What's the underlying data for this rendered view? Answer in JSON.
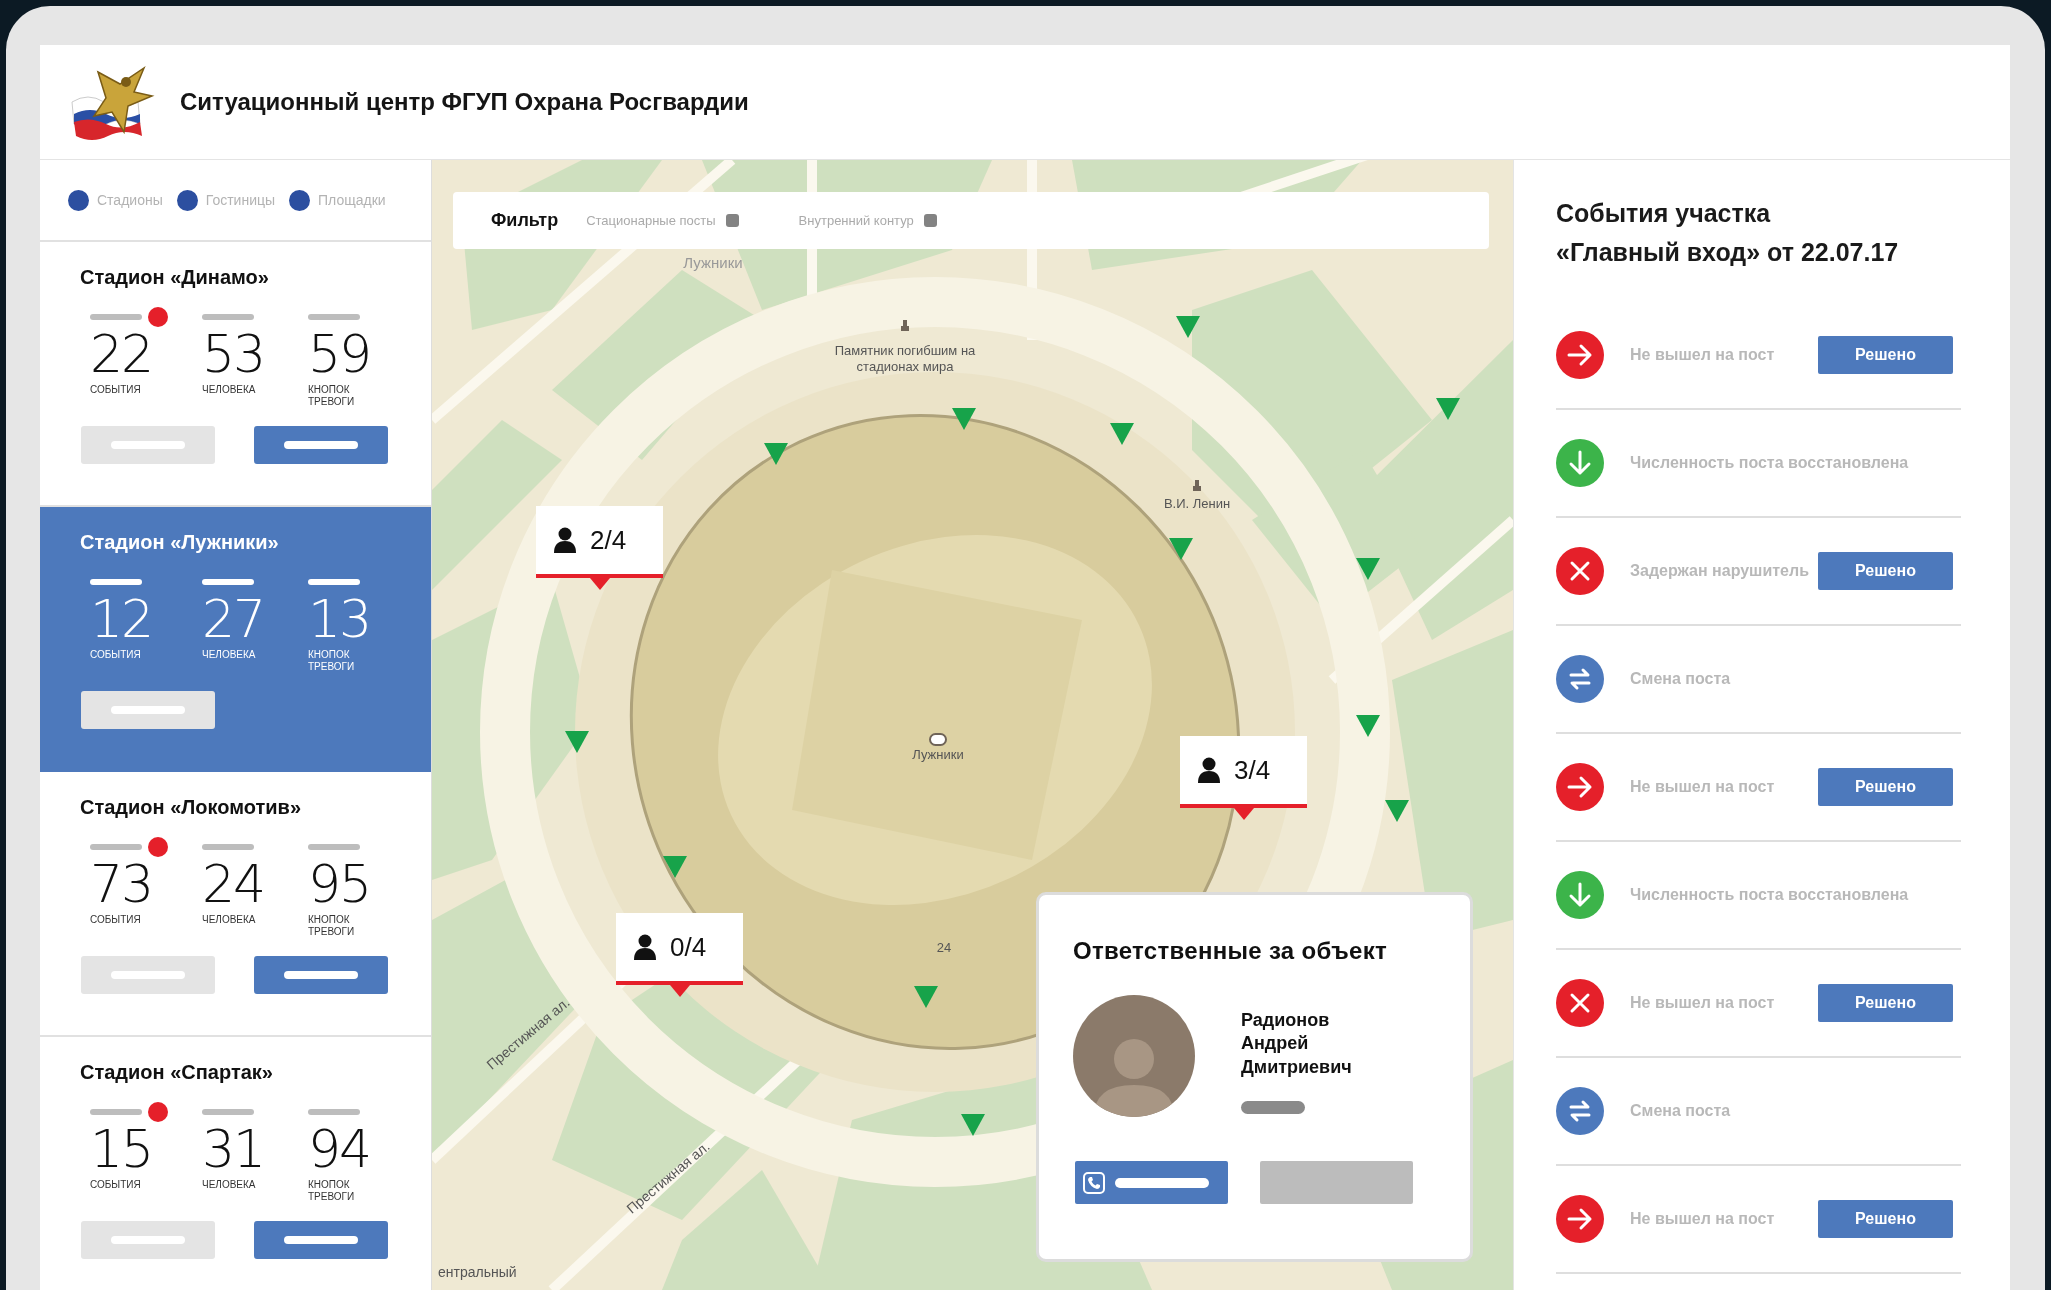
{
  "header": {
    "title": "Ситуационный центр ФГУП Охрана Росгвардии"
  },
  "legend": [
    {
      "label": "Стадионы"
    },
    {
      "label": "Гостиницы"
    },
    {
      "label": "Площадки"
    }
  ],
  "stadiums": [
    {
      "name": "Стадион «Динамо»",
      "selected": false,
      "alert": true,
      "primary_button": true,
      "stats": [
        {
          "value": "22",
          "label": "СОБЫТИЯ"
        },
        {
          "value": "53",
          "label": "ЧЕЛОВЕКА"
        },
        {
          "value": "59",
          "label": "КНОПОК ТРЕВОГИ"
        }
      ]
    },
    {
      "name": "Стадион «Лужники»",
      "selected": true,
      "alert": false,
      "primary_button": false,
      "stats": [
        {
          "value": "12",
          "label": "СОБЫТИЯ"
        },
        {
          "value": "27",
          "label": "ЧЕЛОВЕКА"
        },
        {
          "value": "13",
          "label": "КНОПОК ТРЕВОГИ"
        }
      ]
    },
    {
      "name": "Стадион «Локомотив»",
      "selected": false,
      "alert": true,
      "primary_button": true,
      "stats": [
        {
          "value": "73",
          "label": "СОБЫТИЯ"
        },
        {
          "value": "24",
          "label": "ЧЕЛОВЕКА"
        },
        {
          "value": "95",
          "label": "КНОПОК ТРЕВОГИ"
        }
      ]
    },
    {
      "name": "Стадион «Спартак»",
      "selected": false,
      "alert": true,
      "primary_button": true,
      "stats": [
        {
          "value": "15",
          "label": "СОБЫТИЯ"
        },
        {
          "value": "31",
          "label": "ЧЕЛОВЕКА"
        },
        {
          "value": "94",
          "label": "КНОПОК ТРЕВОГИ"
        }
      ]
    }
  ],
  "map": {
    "filter": {
      "title": "Фильтр",
      "options": [
        {
          "label": "Стационарные посты",
          "checked": false
        },
        {
          "label": "Внутренний контур",
          "checked": false
        }
      ]
    },
    "labels": [
      {
        "kind": "district",
        "text": "Лужники"
      },
      {
        "kind": "poi",
        "text": "Памятник погибшим на стадионах мира"
      },
      {
        "kind": "poi",
        "text": "В.И. Ленин"
      },
      {
        "kind": "stadium",
        "text": "Лужники"
      },
      {
        "kind": "number",
        "text": "24"
      },
      {
        "kind": "street",
        "text": "Престижная ал."
      },
      {
        "kind": "street",
        "text": "Престижная ал."
      },
      {
        "kind": "edge",
        "text": "ентральный"
      }
    ],
    "post_markers": [
      {
        "count": "2/4"
      },
      {
        "count": "3/4"
      },
      {
        "count": "0/4"
      }
    ],
    "responsible": {
      "title": "Ответственные за объект",
      "name": "Радионов Андрей Дмитриевич"
    }
  },
  "events": {
    "title_lines": [
      "События участка",
      "«Главный вход» от 22.07.17"
    ],
    "items": [
      {
        "kind": "absent",
        "text": "Не вышел на пост",
        "action": "Решено"
      },
      {
        "kind": "restored",
        "text": "Численность поста восстановлена"
      },
      {
        "kind": "detained",
        "text": "Задержан нарушитель",
        "action": "Решено"
      },
      {
        "kind": "shift",
        "text": "Смена поста"
      },
      {
        "kind": "absent",
        "text": "Не вышел на пост",
        "action": "Решено"
      },
      {
        "kind": "restored",
        "text": "Численность поста восстановлена"
      },
      {
        "kind": "detained",
        "text": "Не вышел на пост",
        "action": "Решено"
      },
      {
        "kind": "shift",
        "text": "Смена поста"
      },
      {
        "kind": "absent",
        "text": "Не вышел на пост",
        "action": "Решено"
      }
    ]
  }
}
